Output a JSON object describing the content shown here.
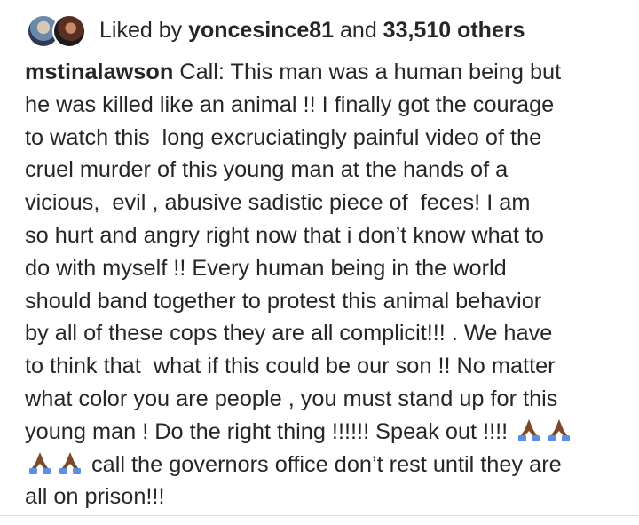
{
  "likes": {
    "prefix": "Liked by ",
    "user": "yoncesince81",
    "connector": " and ",
    "others": "33,510 others"
  },
  "caption": {
    "username": "mstinalawson",
    "lines": [
      " Call: This man was a human being but",
      "he was killed like an animal !! I finally got the courage",
      "to watch this  long excruciatingly painful video of the",
      "cruel murder of this young man at the hands of a",
      "vicious,  evil , abusive sadistic piece of  feces! I am",
      "so hurt and angry right now that i don’t know what to",
      "do with myself !! Every human being in the world",
      "should band together to protest this animal behavior",
      "by all of these cops they are all complicit!!! . We have",
      "to think that  what if this could be our son !! No matter",
      "what color you are people , you must stand up for this",
      "young man ! Do the right thing !!!!!! Speak out !!!! ",
      " call the governors office don’t rest until they are",
      "all on prison!!!"
    ],
    "emoji": "folded-hands-medium-dark-skin-tone-icon"
  },
  "colors": {
    "text": "#262626",
    "skin": "#7a4a2b",
    "sleeve": "#5b8ee6",
    "divider": "#dbdbdb"
  }
}
